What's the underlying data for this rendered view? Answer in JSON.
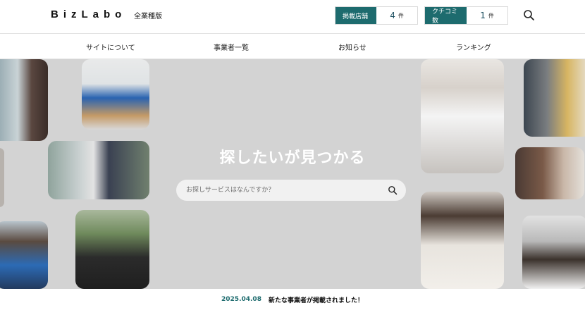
{
  "header": {
    "logo": "BizLabo",
    "edition": "全業種版",
    "stats": [
      {
        "label": "掲載店舗",
        "value": "4",
        "unit": "件"
      },
      {
        "label": "クチコミ数",
        "value": "1",
        "unit": "件"
      }
    ]
  },
  "nav": {
    "items": [
      {
        "label": "サイトについて"
      },
      {
        "label": "事業者一覧"
      },
      {
        "label": "お知らせ"
      },
      {
        "label": "ランキング"
      }
    ]
  },
  "hero": {
    "title": "探したいが見つかる",
    "search_placeholder": "お探しサービスはなんですか？"
  },
  "news": {
    "date": "2025.04.08",
    "message": "新たな事業者が掲載されました！"
  },
  "colors": {
    "accent": "#1d6b6e",
    "hero_bg": "#d3d3d3"
  }
}
